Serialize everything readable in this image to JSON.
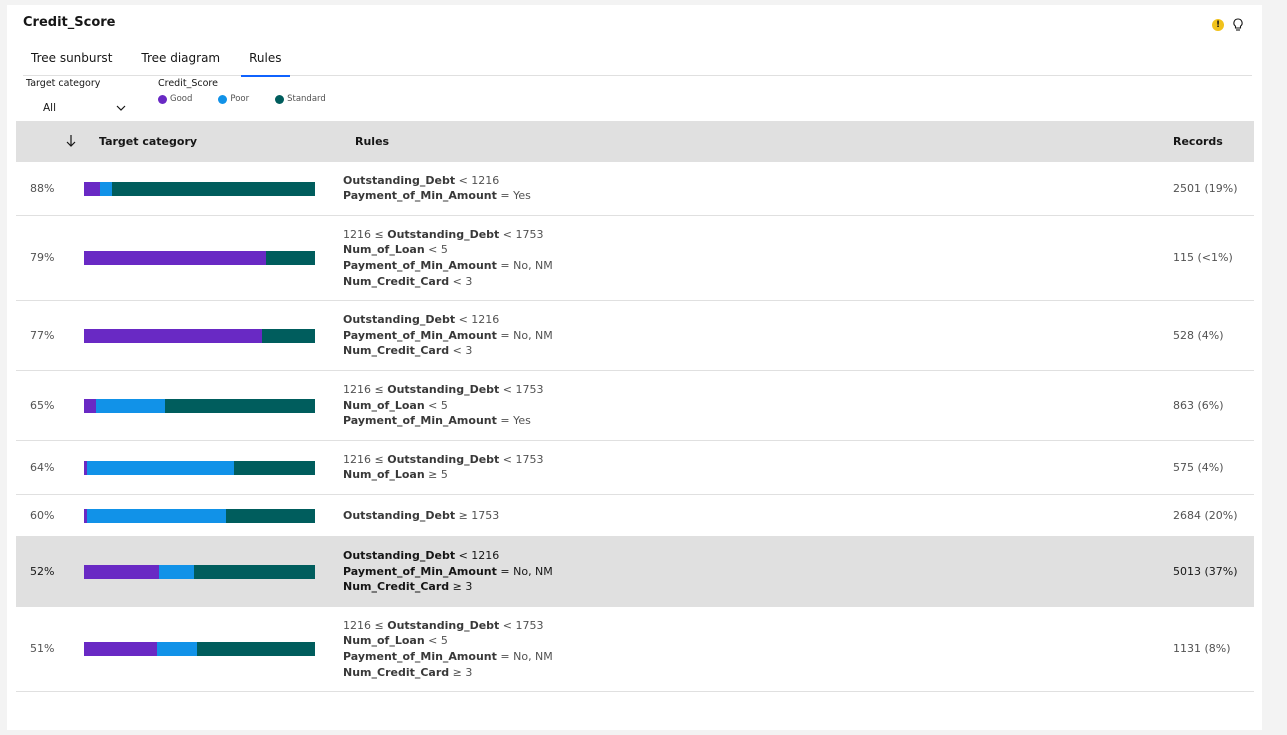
{
  "title": "Credit_Score",
  "tabs": [
    {
      "label": "Tree sunburst",
      "active": false
    },
    {
      "label": "Tree diagram",
      "active": false
    },
    {
      "label": "Rules",
      "active": true
    }
  ],
  "filter": {
    "label": "Target category",
    "value": "All"
  },
  "legend": {
    "title": "Credit_Score",
    "items": [
      {
        "label": "Good",
        "color": "#6929c4"
      },
      {
        "label": "Poor",
        "color": "#1192e8"
      },
      {
        "label": "Standard",
        "color": "#005d5d"
      }
    ]
  },
  "columns": {
    "target": "Target category",
    "rules": "Rules",
    "records": "Records"
  },
  "rows": [
    {
      "pct": "88%",
      "dist": [
        0.07,
        0.05,
        0.88
      ],
      "rules": [
        [
          "",
          "Outstanding_Debt",
          "< 1216"
        ],
        [
          "",
          "Payment_of_Min_Amount",
          "= Yes"
        ]
      ],
      "records": "2501 (19%)",
      "selected": false
    },
    {
      "pct": "79%",
      "dist": [
        0.79,
        0.0,
        0.21
      ],
      "rules": [
        [
          "1216 ≤",
          "Outstanding_Debt",
          "< 1753"
        ],
        [
          "",
          "Num_of_Loan",
          "< 5"
        ],
        [
          "",
          "Payment_of_Min_Amount",
          "= No, NM"
        ],
        [
          "",
          "Num_Credit_Card",
          "< 3"
        ]
      ],
      "records": "115 (<1%)",
      "selected": false
    },
    {
      "pct": "77%",
      "dist": [
        0.77,
        0.0,
        0.23
      ],
      "rules": [
        [
          "",
          "Outstanding_Debt",
          "< 1216"
        ],
        [
          "",
          "Payment_of_Min_Amount",
          "= No, NM"
        ],
        [
          "",
          "Num_Credit_Card",
          "< 3"
        ]
      ],
      "records": "528 (4%)",
      "selected": false
    },
    {
      "pct": "65%",
      "dist": [
        0.05,
        0.3,
        0.65
      ],
      "rules": [
        [
          "1216 ≤",
          "Outstanding_Debt",
          "< 1753"
        ],
        [
          "",
          "Num_of_Loan",
          "< 5"
        ],
        [
          "",
          "Payment_of_Min_Amount",
          "= Yes"
        ]
      ],
      "records": "863 (6%)",
      "selected": false
    },
    {
      "pct": "64%",
      "dist": [
        0.015,
        0.635,
        0.35
      ],
      "rules": [
        [
          "1216 ≤",
          "Outstanding_Debt",
          "< 1753"
        ],
        [
          "",
          "Num_of_Loan",
          "≥ 5"
        ]
      ],
      "records": "575 (4%)",
      "selected": false
    },
    {
      "pct": "60%",
      "dist": [
        0.015,
        0.6,
        0.385
      ],
      "rules": [
        [
          "",
          "Outstanding_Debt",
          "≥ 1753"
        ]
      ],
      "records": "2684 (20%)",
      "selected": false
    },
    {
      "pct": "52%",
      "dist": [
        0.325,
        0.15,
        0.525
      ],
      "rules": [
        [
          "",
          "Outstanding_Debt",
          "< 1216"
        ],
        [
          "",
          "Payment_of_Min_Amount",
          "= No, NM"
        ],
        [
          "",
          "Num_Credit_Card",
          "≥ 3"
        ]
      ],
      "records": "5013 (37%)",
      "selected": true
    },
    {
      "pct": "51%",
      "dist": [
        0.315,
        0.175,
        0.51
      ],
      "rules": [
        [
          "1216 ≤",
          "Outstanding_Debt",
          "< 1753"
        ],
        [
          "",
          "Num_of_Loan",
          "< 5"
        ],
        [
          "",
          "Payment_of_Min_Amount",
          "= No, NM"
        ],
        [
          "",
          "Num_Credit_Card",
          "≥ 3"
        ]
      ],
      "records": "1131 (8%)",
      "selected": false
    }
  ]
}
